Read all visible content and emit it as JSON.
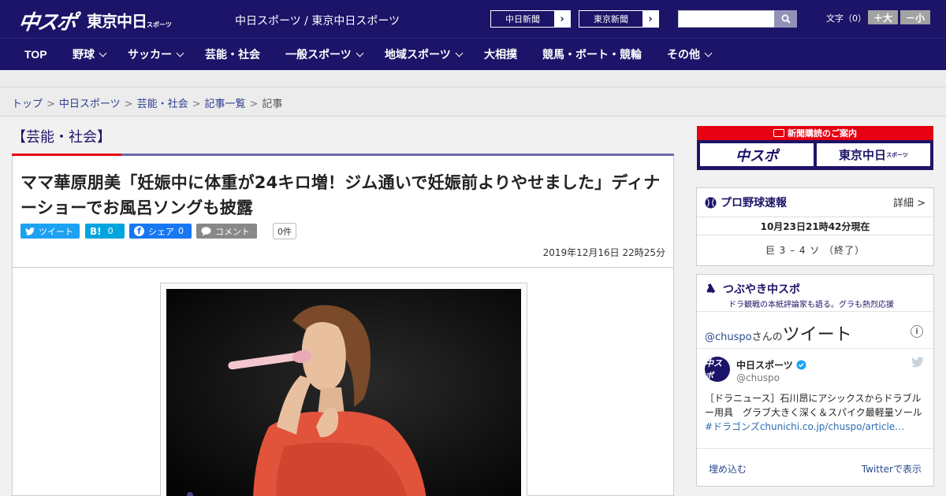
{
  "header": {
    "logo_main": "中スポ",
    "logo_tokyo": "東京中日",
    "logo_tokyo_small": "スポーツ",
    "subtitle": "中日スポーツ / 東京中日スポーツ",
    "chunichi_btn": "中日新聞",
    "tokyo_btn": "東京新聞",
    "search_placeholder": "",
    "font_size_label": "文字（0）",
    "font_larger": "＋大",
    "font_smaller": "－小"
  },
  "nav": {
    "items": [
      "TOP",
      "野球",
      "サッカー",
      "芸能・社会",
      "一般スポーツ",
      "地域スポーツ",
      "大相撲",
      "競馬・ボート・競輪",
      "その他"
    ]
  },
  "breadcrumb": {
    "items": [
      "トップ",
      "中日スポーツ",
      "芸能・社会",
      "記事一覧"
    ],
    "current": "記事",
    "separator": ">"
  },
  "article": {
    "section": "【芸能・社会】",
    "title": "ママ華原朋美「妊娠中に体重が24キロ増！ジム通いで妊娠前よりやせました」ディナーショーでお風呂ソングも披露",
    "share": {
      "tweet": "ツイート",
      "hatena_label": "B!",
      "hatena_count": "0",
      "facebook": "シェア",
      "facebook_count": "0",
      "comment": "コメント",
      "comment_count": "0件"
    },
    "date": "2019年12月16日 22時25分"
  },
  "sidebar": {
    "subscribe_header": "新聞購読のご案内",
    "subscribe_left": "中スポ",
    "subscribe_right": "東京中日",
    "subscribe_right_small": "スポーツ",
    "baseball": {
      "title": "プロ野球速報",
      "more": "詳細 >",
      "updated": "10月23日21時42分現在",
      "score": "巨 3 – 4 ソ （終了）"
    },
    "twitter": {
      "title": "つぶやき中スポ",
      "subtitle": "ドラ観戦の本紙評論家も語る。グラも熱烈応援",
      "head_handle": "@chuspo",
      "head_mid": "さんの",
      "head_big": "ツイート",
      "avatar_text": "中スポ",
      "account_name": "中日スポーツ",
      "account_handle": "@chuspo",
      "tweet_text": "［ドラニュース］石川昂にアシックスからドラブルー用具　グラブ大きく深く＆スパイク最軽量ソール",
      "tweet_link": "#ドラゴンズchunichi.co.jp/chuspo/article…",
      "embed": "埋め込む",
      "view_on_twitter": "Twitterで表示"
    }
  },
  "colors": {
    "brand_navy": "#1c1468",
    "accent_red": "#e60012",
    "twitter_blue": "#1da1f2",
    "hatena_blue": "#00a4de",
    "facebook_blue": "#1877f2"
  }
}
